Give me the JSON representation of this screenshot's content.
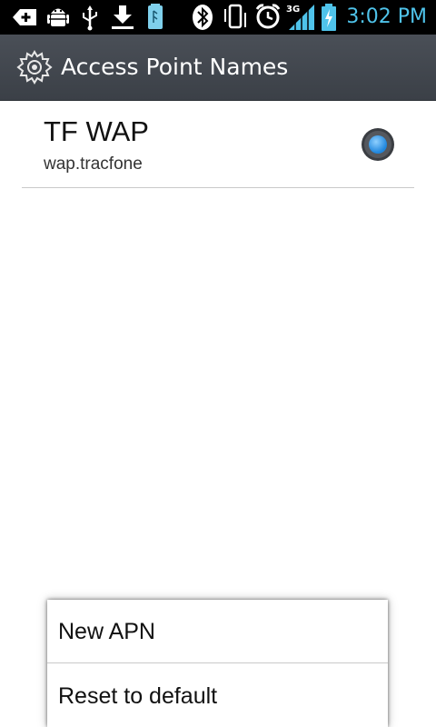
{
  "status_bar": {
    "time": "3:02 PM",
    "network_label": "3G",
    "time_color": "#4fc3ea",
    "icons": [
      "add-notification-icon",
      "android-debug-icon",
      "usb-icon",
      "download-icon",
      "sd-card-icon",
      "bluetooth-icon",
      "vibrate-icon",
      "alarm-icon",
      "signal-3g-icon",
      "battery-charging-icon"
    ]
  },
  "action_bar": {
    "title": "Access Point Names",
    "icon": "settings-gear-icon"
  },
  "apn_list": [
    {
      "name": "TF WAP",
      "apn": "wap.tracfone",
      "selected": true
    }
  ],
  "menu": {
    "items": [
      {
        "label": "New APN"
      },
      {
        "label": "Reset to default"
      }
    ]
  },
  "colors": {
    "accent": "#4fc3ea",
    "radio_fill": "#3aa0e8",
    "action_bar": "#43474f"
  }
}
